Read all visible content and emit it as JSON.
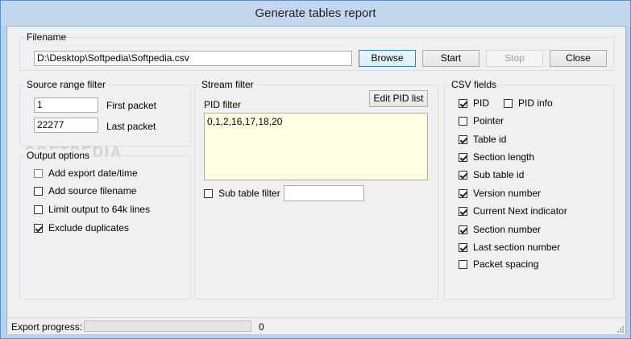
{
  "window": {
    "title": "Generate tables report"
  },
  "filename": {
    "legend": "Filename",
    "path": "D:\\Desktop\\Softpedia\\Softpedia.csv",
    "browse_label": "Browse",
    "start_label": "Start",
    "stop_label": "Stop",
    "close_label": "Close"
  },
  "source_range": {
    "legend": "Source range filter",
    "first_value": "1",
    "first_label": "First packet",
    "last_value": "22277",
    "last_label": "Last packet"
  },
  "output_options": {
    "legend": "Output options",
    "items": [
      {
        "label": "Add export date/time",
        "checked": false
      },
      {
        "label": "Add source filename",
        "checked": false
      },
      {
        "label": "Limit output to 64k lines",
        "checked": false
      },
      {
        "label": "Exclude duplicates",
        "checked": true
      }
    ]
  },
  "stream_filter": {
    "legend": "Stream filter",
    "pid_label": "PID filter",
    "edit_pid_label": "Edit PID list",
    "pid_value": "0,1,2,16,17,18,20",
    "sub_table_label": "Sub table filter",
    "sub_table_checked": false,
    "sub_table_value": ""
  },
  "csv_fields": {
    "legend": "CSV fields",
    "pid": {
      "label": "PID",
      "checked": true
    },
    "pid_info": {
      "label": "PID info",
      "checked": false
    },
    "items": [
      {
        "label": "Pointer",
        "checked": false
      },
      {
        "label": "Table id",
        "checked": true
      },
      {
        "label": "Section length",
        "checked": true
      },
      {
        "label": "Sub table id",
        "checked": true
      },
      {
        "label": "Version number",
        "checked": true
      },
      {
        "label": "Current Next indicator",
        "checked": true
      },
      {
        "label": "Section number",
        "checked": true
      },
      {
        "label": "Last section number",
        "checked": true
      },
      {
        "label": "Packet spacing",
        "checked": false
      }
    ]
  },
  "status": {
    "progress_label": "Export progress:",
    "progress_value": "0",
    "progress_fraction": 0
  },
  "watermark": "SOFTPEDIA"
}
